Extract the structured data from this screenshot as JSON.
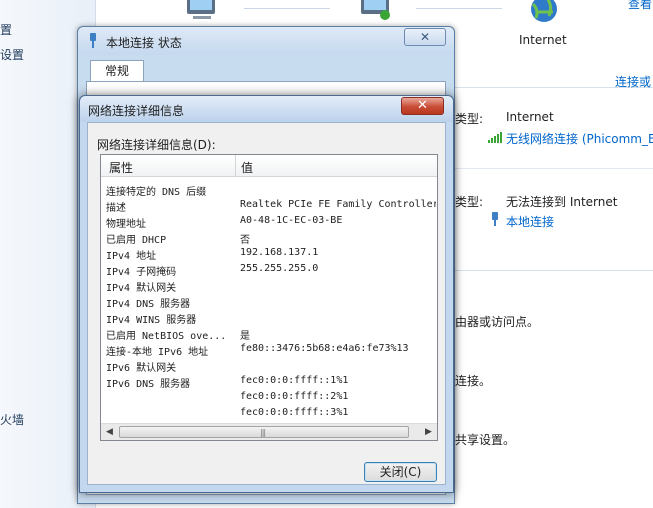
{
  "background": {
    "left_pane_items": [
      "置",
      "设置",
      "火墙"
    ],
    "internet_label": "Internet",
    "top_right_link": "查看",
    "connect_or_disconnect_link": "连接或",
    "network1": {
      "access_type_label": "类型:",
      "access_type_value": "Internet",
      "connection_link": "无线网络连接 (Phicomm_E"
    },
    "network2": {
      "access_type_label": "类型:",
      "access_type_value": "无法连接到 Internet",
      "connection_link": "本地连接"
    },
    "line_router": "由器或访问点。",
    "line_connect": "连接。",
    "line_sharing": "共享设置。"
  },
  "status_window": {
    "title": "本地连接 状态",
    "close": "✕",
    "tab_general": "常规"
  },
  "details_window": {
    "title": "网络连接详细信息",
    "close": "✕",
    "list_caption": "网络连接详细信息(D):",
    "columns": {
      "property": "属性",
      "value": "值"
    },
    "rows": [
      {
        "property": "连接特定的 DNS 后缀",
        "value": ""
      },
      {
        "property": "描述",
        "value": "Realtek PCIe FE Family Controller"
      },
      {
        "property": "物理地址",
        "value": "A0-48-1C-EC-03-BE"
      },
      {
        "property": "已启用 DHCP",
        "value": "否"
      },
      {
        "property": "IPv4 地址",
        "value": "192.168.137.1"
      },
      {
        "property": "IPv4 子网掩码",
        "value": "255.255.255.0"
      },
      {
        "property": "IPv4 默认网关",
        "value": ""
      },
      {
        "property": "IPv4 DNS 服务器",
        "value": ""
      },
      {
        "property": "IPv4 WINS 服务器",
        "value": ""
      },
      {
        "property": "已启用 NetBIOS ove...",
        "value": "是"
      },
      {
        "property": "连接-本地 IPv6 地址",
        "value": "fe80::3476:5b68:e4a6:fe73%13"
      },
      {
        "property": "IPv6 默认网关",
        "value": ""
      },
      {
        "property": "IPv6 DNS 服务器",
        "value": "fec0:0:0:ffff::1%1"
      },
      {
        "property": "",
        "value": "fec0:0:0:ffff::2%1"
      },
      {
        "property": "",
        "value": "fec0:0:0:ffff::3%1"
      }
    ],
    "scroll_left": "◀",
    "scroll_right": "▶",
    "scroll_grip": "|||",
    "close_button": "关闭(C)"
  },
  "colors": {
    "link": "#0066cc",
    "window_frame": "#c3d7ee",
    "close_red": "#c94c36"
  }
}
